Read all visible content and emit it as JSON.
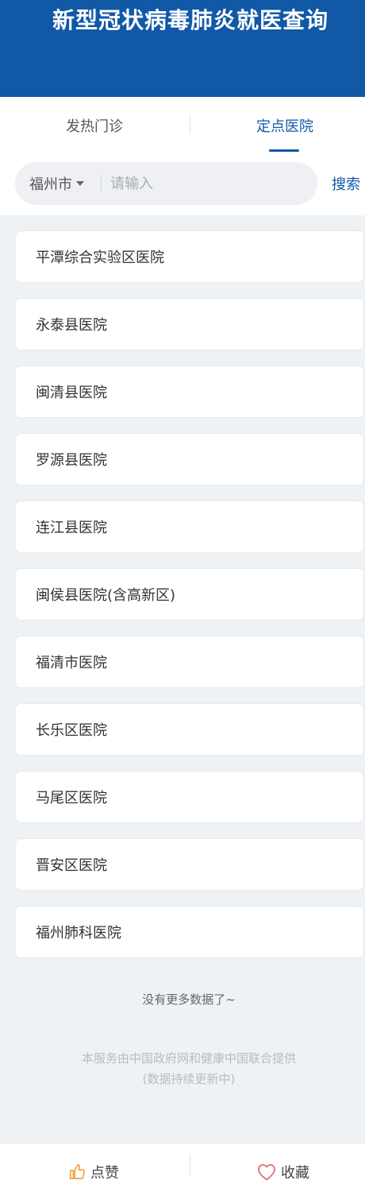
{
  "header": {
    "title": "新型冠状病毒肺炎就医查询"
  },
  "tabs": [
    {
      "label": "发热门诊",
      "active": false
    },
    {
      "label": "定点医院",
      "active": true
    }
  ],
  "search": {
    "city": "福州市",
    "placeholder": "请输入",
    "value": "",
    "button_label": "搜索"
  },
  "hospitals": [
    "平潭综合实验区医院",
    "永泰县医院",
    "闽清县医院",
    "罗源县医院",
    "连江县医院",
    "闽侯县医院(含高新区)",
    "福清市医院",
    "长乐区医院",
    "马尾区医院",
    "晋安区医院",
    "福州肺科医院"
  ],
  "list_end_text": "没有更多数据了~",
  "footer": {
    "line1": "本服务由中国政府网和健康中国联合提供",
    "line2": "(数据持续更新中)"
  },
  "bottom_bar": {
    "like_label": "点赞",
    "like_icon": "thumbs-up-icon",
    "favorite_label": "收藏",
    "favorite_icon": "heart-icon"
  },
  "colors": {
    "brand_blue": "#1158a7",
    "background": "#eef2f5",
    "like_icon": "#f0a23a",
    "favorite_icon": "#e0706c"
  }
}
